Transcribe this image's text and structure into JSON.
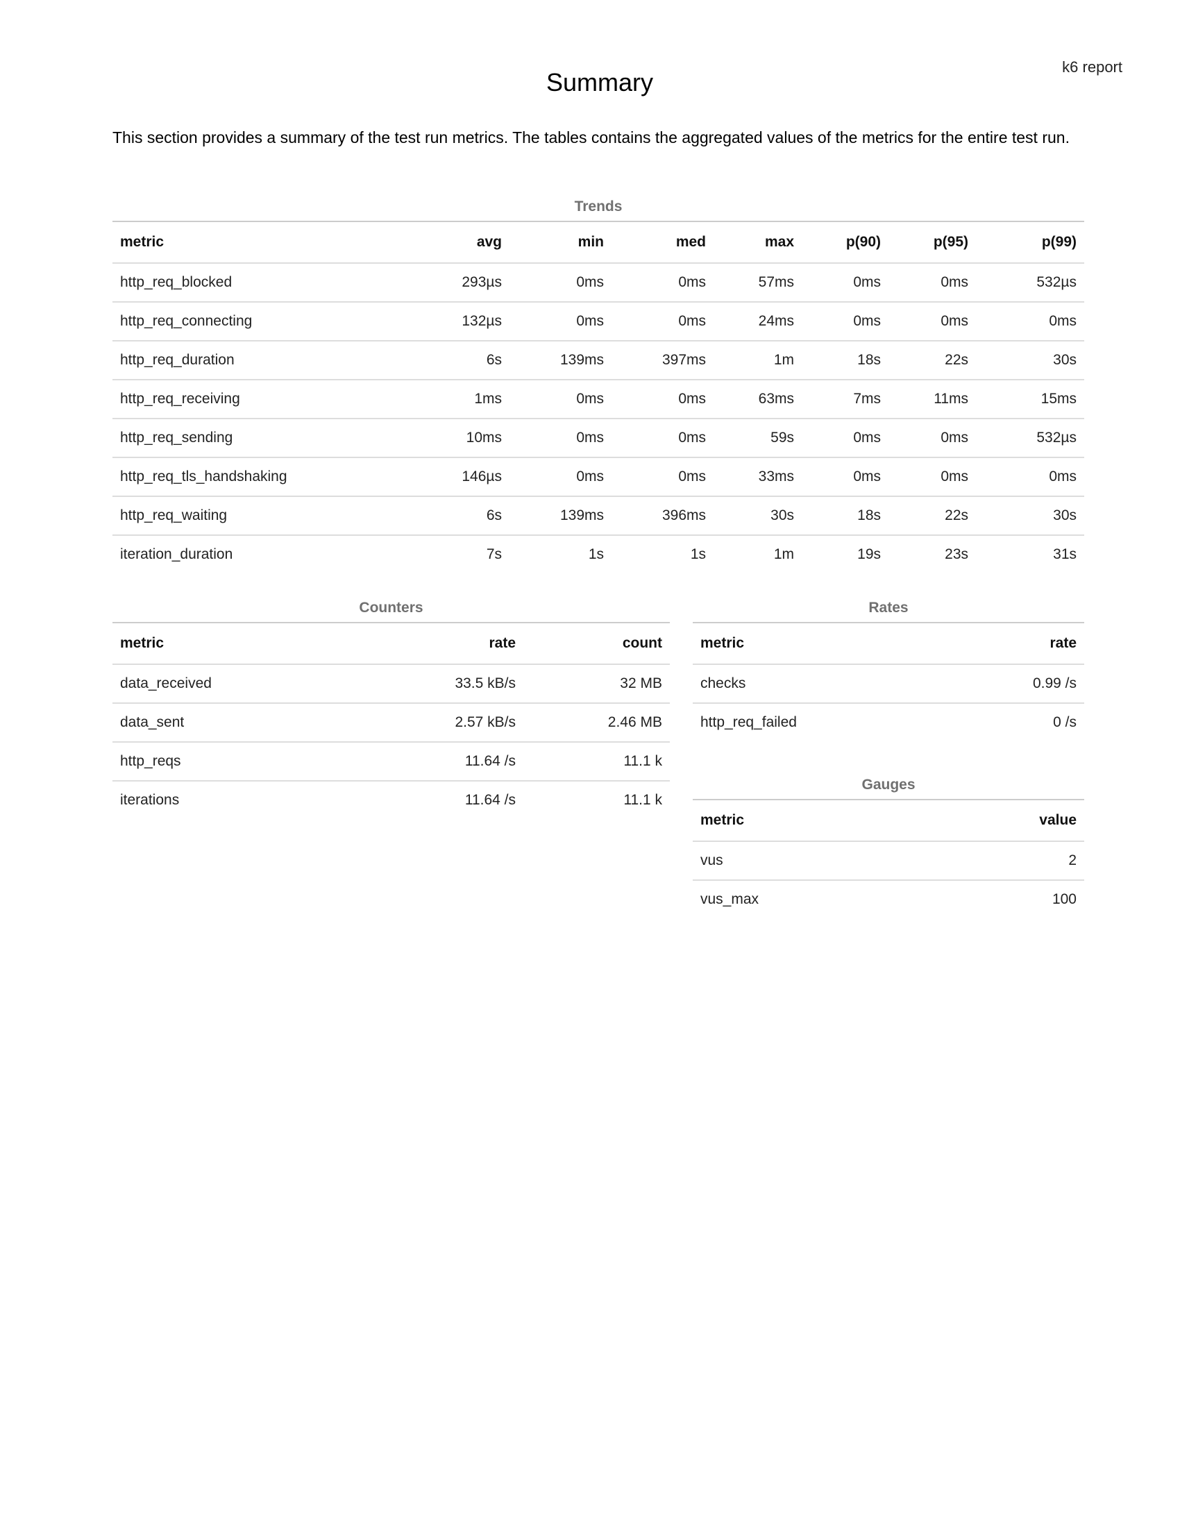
{
  "header": {
    "right": "k6 report"
  },
  "title": "Summary",
  "intro": "This section provides a summary of the test run metrics. The tables contains the aggregated values of the metrics for the entire test run.",
  "trends": {
    "caption": "Trends",
    "columns": [
      "metric",
      "avg",
      "min",
      "med",
      "max",
      "p(90)",
      "p(95)",
      "p(99)"
    ],
    "rows": [
      [
        "http_req_blocked",
        "293µs",
        "0ms",
        "0ms",
        "57ms",
        "0ms",
        "0ms",
        "532µs"
      ],
      [
        "http_req_connecting",
        "132µs",
        "0ms",
        "0ms",
        "24ms",
        "0ms",
        "0ms",
        "0ms"
      ],
      [
        "http_req_duration",
        "6s",
        "139ms",
        "397ms",
        "1m",
        "18s",
        "22s",
        "30s"
      ],
      [
        "http_req_receiving",
        "1ms",
        "0ms",
        "0ms",
        "63ms",
        "7ms",
        "11ms",
        "15ms"
      ],
      [
        "http_req_sending",
        "10ms",
        "0ms",
        "0ms",
        "59s",
        "0ms",
        "0ms",
        "532µs"
      ],
      [
        "http_req_tls_handshaking",
        "146µs",
        "0ms",
        "0ms",
        "33ms",
        "0ms",
        "0ms",
        "0ms"
      ],
      [
        "http_req_waiting",
        "6s",
        "139ms",
        "396ms",
        "30s",
        "18s",
        "22s",
        "30s"
      ],
      [
        "iteration_duration",
        "7s",
        "1s",
        "1s",
        "1m",
        "19s",
        "23s",
        "31s"
      ]
    ]
  },
  "counters": {
    "caption": "Counters",
    "columns": [
      "metric",
      "rate",
      "count"
    ],
    "rows": [
      [
        "data_received",
        "33.5 kB/s",
        "32 MB"
      ],
      [
        "data_sent",
        "2.57 kB/s",
        "2.46 MB"
      ],
      [
        "http_reqs",
        "11.64 /s",
        "11.1 k"
      ],
      [
        "iterations",
        "11.64 /s",
        "11.1 k"
      ]
    ]
  },
  "rates": {
    "caption": "Rates",
    "columns": [
      "metric",
      "rate"
    ],
    "rows": [
      [
        "checks",
        "0.99 /s"
      ],
      [
        "http_req_failed",
        "0 /s"
      ]
    ]
  },
  "gauges": {
    "caption": "Gauges",
    "columns": [
      "metric",
      "value"
    ],
    "rows": [
      [
        "vus",
        "2"
      ],
      [
        "vus_max",
        "100"
      ]
    ]
  }
}
